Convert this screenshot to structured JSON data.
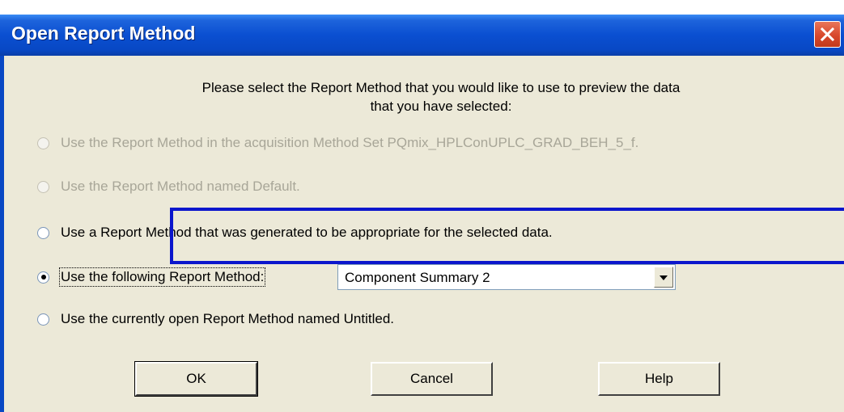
{
  "window": {
    "title": "Open Report Method"
  },
  "prompt": {
    "line1": "Please select the Report Method that you would like to use to preview the data",
    "line2": "that you have selected:"
  },
  "options": [
    {
      "label": "Use the Report Method in the acquisition Method Set PQmix_HPLConUPLC_GRAD_BEH_5_f.",
      "enabled": false,
      "selected": false
    },
    {
      "label": "Use the Report Method named Default.",
      "enabled": false,
      "selected": false
    },
    {
      "label": "Use a Report Method that was generated to be appropriate for the selected data.",
      "enabled": true,
      "selected": false
    },
    {
      "label": "Use the following Report Method:",
      "enabled": true,
      "selected": true
    },
    {
      "label": "Use the currently open Report Method named Untitled.",
      "enabled": true,
      "selected": false
    }
  ],
  "report_method_combo": {
    "value": "Component Summary 2"
  },
  "buttons": {
    "ok": "OK",
    "cancel": "Cancel",
    "help": "Help"
  },
  "colors": {
    "titlebar": "#0a4fd1",
    "dialog_bg": "#ece9d8",
    "highlight": "#0b16cc",
    "close": "#d8482c"
  },
  "icons": {
    "close": "close-icon",
    "dropdown": "chevron-down-icon"
  }
}
